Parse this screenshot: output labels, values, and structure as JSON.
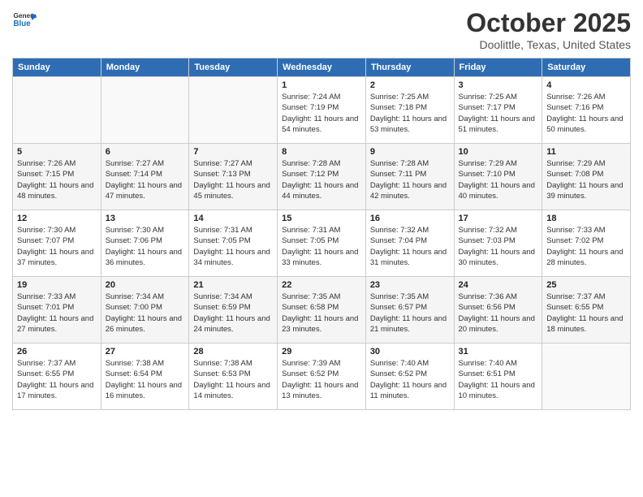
{
  "header": {
    "logo": {
      "general": "General",
      "blue": "Blue"
    },
    "title": "October 2025",
    "location": "Doolittle, Texas, United States"
  },
  "days_of_week": [
    "Sunday",
    "Monday",
    "Tuesday",
    "Wednesday",
    "Thursday",
    "Friday",
    "Saturday"
  ],
  "weeks": [
    [
      {
        "day": "",
        "info": ""
      },
      {
        "day": "",
        "info": ""
      },
      {
        "day": "",
        "info": ""
      },
      {
        "day": "1",
        "info": "Sunrise: 7:24 AM\nSunset: 7:19 PM\nDaylight: 11 hours\nand 54 minutes."
      },
      {
        "day": "2",
        "info": "Sunrise: 7:25 AM\nSunset: 7:18 PM\nDaylight: 11 hours\nand 53 minutes."
      },
      {
        "day": "3",
        "info": "Sunrise: 7:25 AM\nSunset: 7:17 PM\nDaylight: 11 hours\nand 51 minutes."
      },
      {
        "day": "4",
        "info": "Sunrise: 7:26 AM\nSunset: 7:16 PM\nDaylight: 11 hours\nand 50 minutes."
      }
    ],
    [
      {
        "day": "5",
        "info": "Sunrise: 7:26 AM\nSunset: 7:15 PM\nDaylight: 11 hours\nand 48 minutes."
      },
      {
        "day": "6",
        "info": "Sunrise: 7:27 AM\nSunset: 7:14 PM\nDaylight: 11 hours\nand 47 minutes."
      },
      {
        "day": "7",
        "info": "Sunrise: 7:27 AM\nSunset: 7:13 PM\nDaylight: 11 hours\nand 45 minutes."
      },
      {
        "day": "8",
        "info": "Sunrise: 7:28 AM\nSunset: 7:12 PM\nDaylight: 11 hours\nand 44 minutes."
      },
      {
        "day": "9",
        "info": "Sunrise: 7:28 AM\nSunset: 7:11 PM\nDaylight: 11 hours\nand 42 minutes."
      },
      {
        "day": "10",
        "info": "Sunrise: 7:29 AM\nSunset: 7:10 PM\nDaylight: 11 hours\nand 40 minutes."
      },
      {
        "day": "11",
        "info": "Sunrise: 7:29 AM\nSunset: 7:08 PM\nDaylight: 11 hours\nand 39 minutes."
      }
    ],
    [
      {
        "day": "12",
        "info": "Sunrise: 7:30 AM\nSunset: 7:07 PM\nDaylight: 11 hours\nand 37 minutes."
      },
      {
        "day": "13",
        "info": "Sunrise: 7:30 AM\nSunset: 7:06 PM\nDaylight: 11 hours\nand 36 minutes."
      },
      {
        "day": "14",
        "info": "Sunrise: 7:31 AM\nSunset: 7:05 PM\nDaylight: 11 hours\nand 34 minutes."
      },
      {
        "day": "15",
        "info": "Sunrise: 7:31 AM\nSunset: 7:05 PM\nDaylight: 11 hours\nand 33 minutes."
      },
      {
        "day": "16",
        "info": "Sunrise: 7:32 AM\nSunset: 7:04 PM\nDaylight: 11 hours\nand 31 minutes."
      },
      {
        "day": "17",
        "info": "Sunrise: 7:32 AM\nSunset: 7:03 PM\nDaylight: 11 hours\nand 30 minutes."
      },
      {
        "day": "18",
        "info": "Sunrise: 7:33 AM\nSunset: 7:02 PM\nDaylight: 11 hours\nand 28 minutes."
      }
    ],
    [
      {
        "day": "19",
        "info": "Sunrise: 7:33 AM\nSunset: 7:01 PM\nDaylight: 11 hours\nand 27 minutes."
      },
      {
        "day": "20",
        "info": "Sunrise: 7:34 AM\nSunset: 7:00 PM\nDaylight: 11 hours\nand 26 minutes."
      },
      {
        "day": "21",
        "info": "Sunrise: 7:34 AM\nSunset: 6:59 PM\nDaylight: 11 hours\nand 24 minutes."
      },
      {
        "day": "22",
        "info": "Sunrise: 7:35 AM\nSunset: 6:58 PM\nDaylight: 11 hours\nand 23 minutes."
      },
      {
        "day": "23",
        "info": "Sunrise: 7:35 AM\nSunset: 6:57 PM\nDaylight: 11 hours\nand 21 minutes."
      },
      {
        "day": "24",
        "info": "Sunrise: 7:36 AM\nSunset: 6:56 PM\nDaylight: 11 hours\nand 20 minutes."
      },
      {
        "day": "25",
        "info": "Sunrise: 7:37 AM\nSunset: 6:55 PM\nDaylight: 11 hours\nand 18 minutes."
      }
    ],
    [
      {
        "day": "26",
        "info": "Sunrise: 7:37 AM\nSunset: 6:55 PM\nDaylight: 11 hours\nand 17 minutes."
      },
      {
        "day": "27",
        "info": "Sunrise: 7:38 AM\nSunset: 6:54 PM\nDaylight: 11 hours\nand 16 minutes."
      },
      {
        "day": "28",
        "info": "Sunrise: 7:38 AM\nSunset: 6:53 PM\nDaylight: 11 hours\nand 14 minutes."
      },
      {
        "day": "29",
        "info": "Sunrise: 7:39 AM\nSunset: 6:52 PM\nDaylight: 11 hours\nand 13 minutes."
      },
      {
        "day": "30",
        "info": "Sunrise: 7:40 AM\nSunset: 6:52 PM\nDaylight: 11 hours\nand 11 minutes."
      },
      {
        "day": "31",
        "info": "Sunrise: 7:40 AM\nSunset: 6:51 PM\nDaylight: 11 hours\nand 10 minutes."
      },
      {
        "day": "",
        "info": ""
      }
    ]
  ]
}
